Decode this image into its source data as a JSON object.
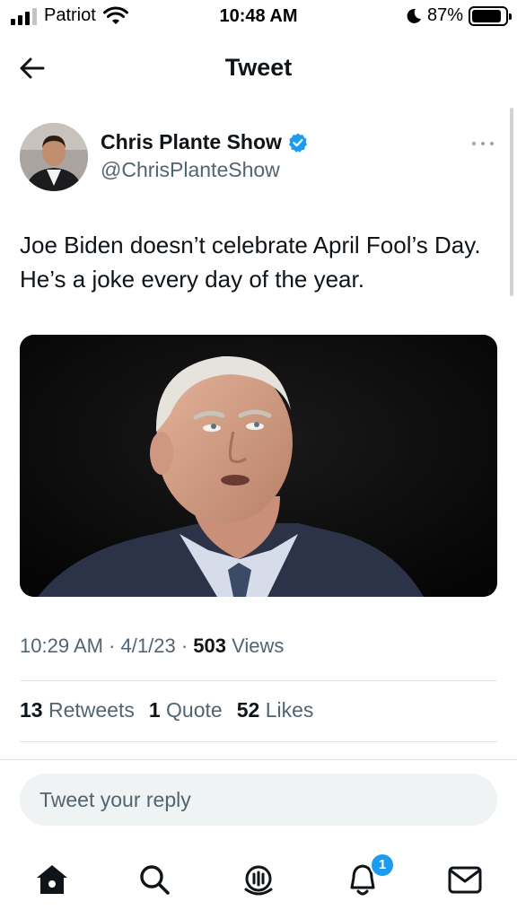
{
  "status_bar": {
    "carrier": "Patriot",
    "time": "10:48 AM",
    "battery": "87%"
  },
  "header": {
    "title": "Tweet"
  },
  "tweet": {
    "author_name": "Chris Plante Show",
    "author_handle": "@ChrisPlanteShow",
    "text": "Joe Biden doesn’t celebrate April Fool’s Day. He’s a joke every day of the year.",
    "time": "10:29 AM",
    "date": "4/1/23",
    "views_count": "503",
    "views_label": "Views",
    "retweets_count": "13",
    "retweets_label": "Retweets",
    "quotes_count": "1",
    "quotes_label": "Quote",
    "likes_count": "52",
    "likes_label": "Likes"
  },
  "reply": {
    "placeholder": "Tweet your reply"
  },
  "nav": {
    "notifications_badge": "1",
    "items": [
      "home-icon",
      "search-icon",
      "spaces-icon",
      "notifications-icon",
      "messages-icon"
    ]
  },
  "colors": {
    "accent": "#1d9bf0",
    "text_primary": "#0f1419",
    "text_secondary": "#536471",
    "divider": "#e1e5e8",
    "reply_bg": "#eff3f4"
  }
}
